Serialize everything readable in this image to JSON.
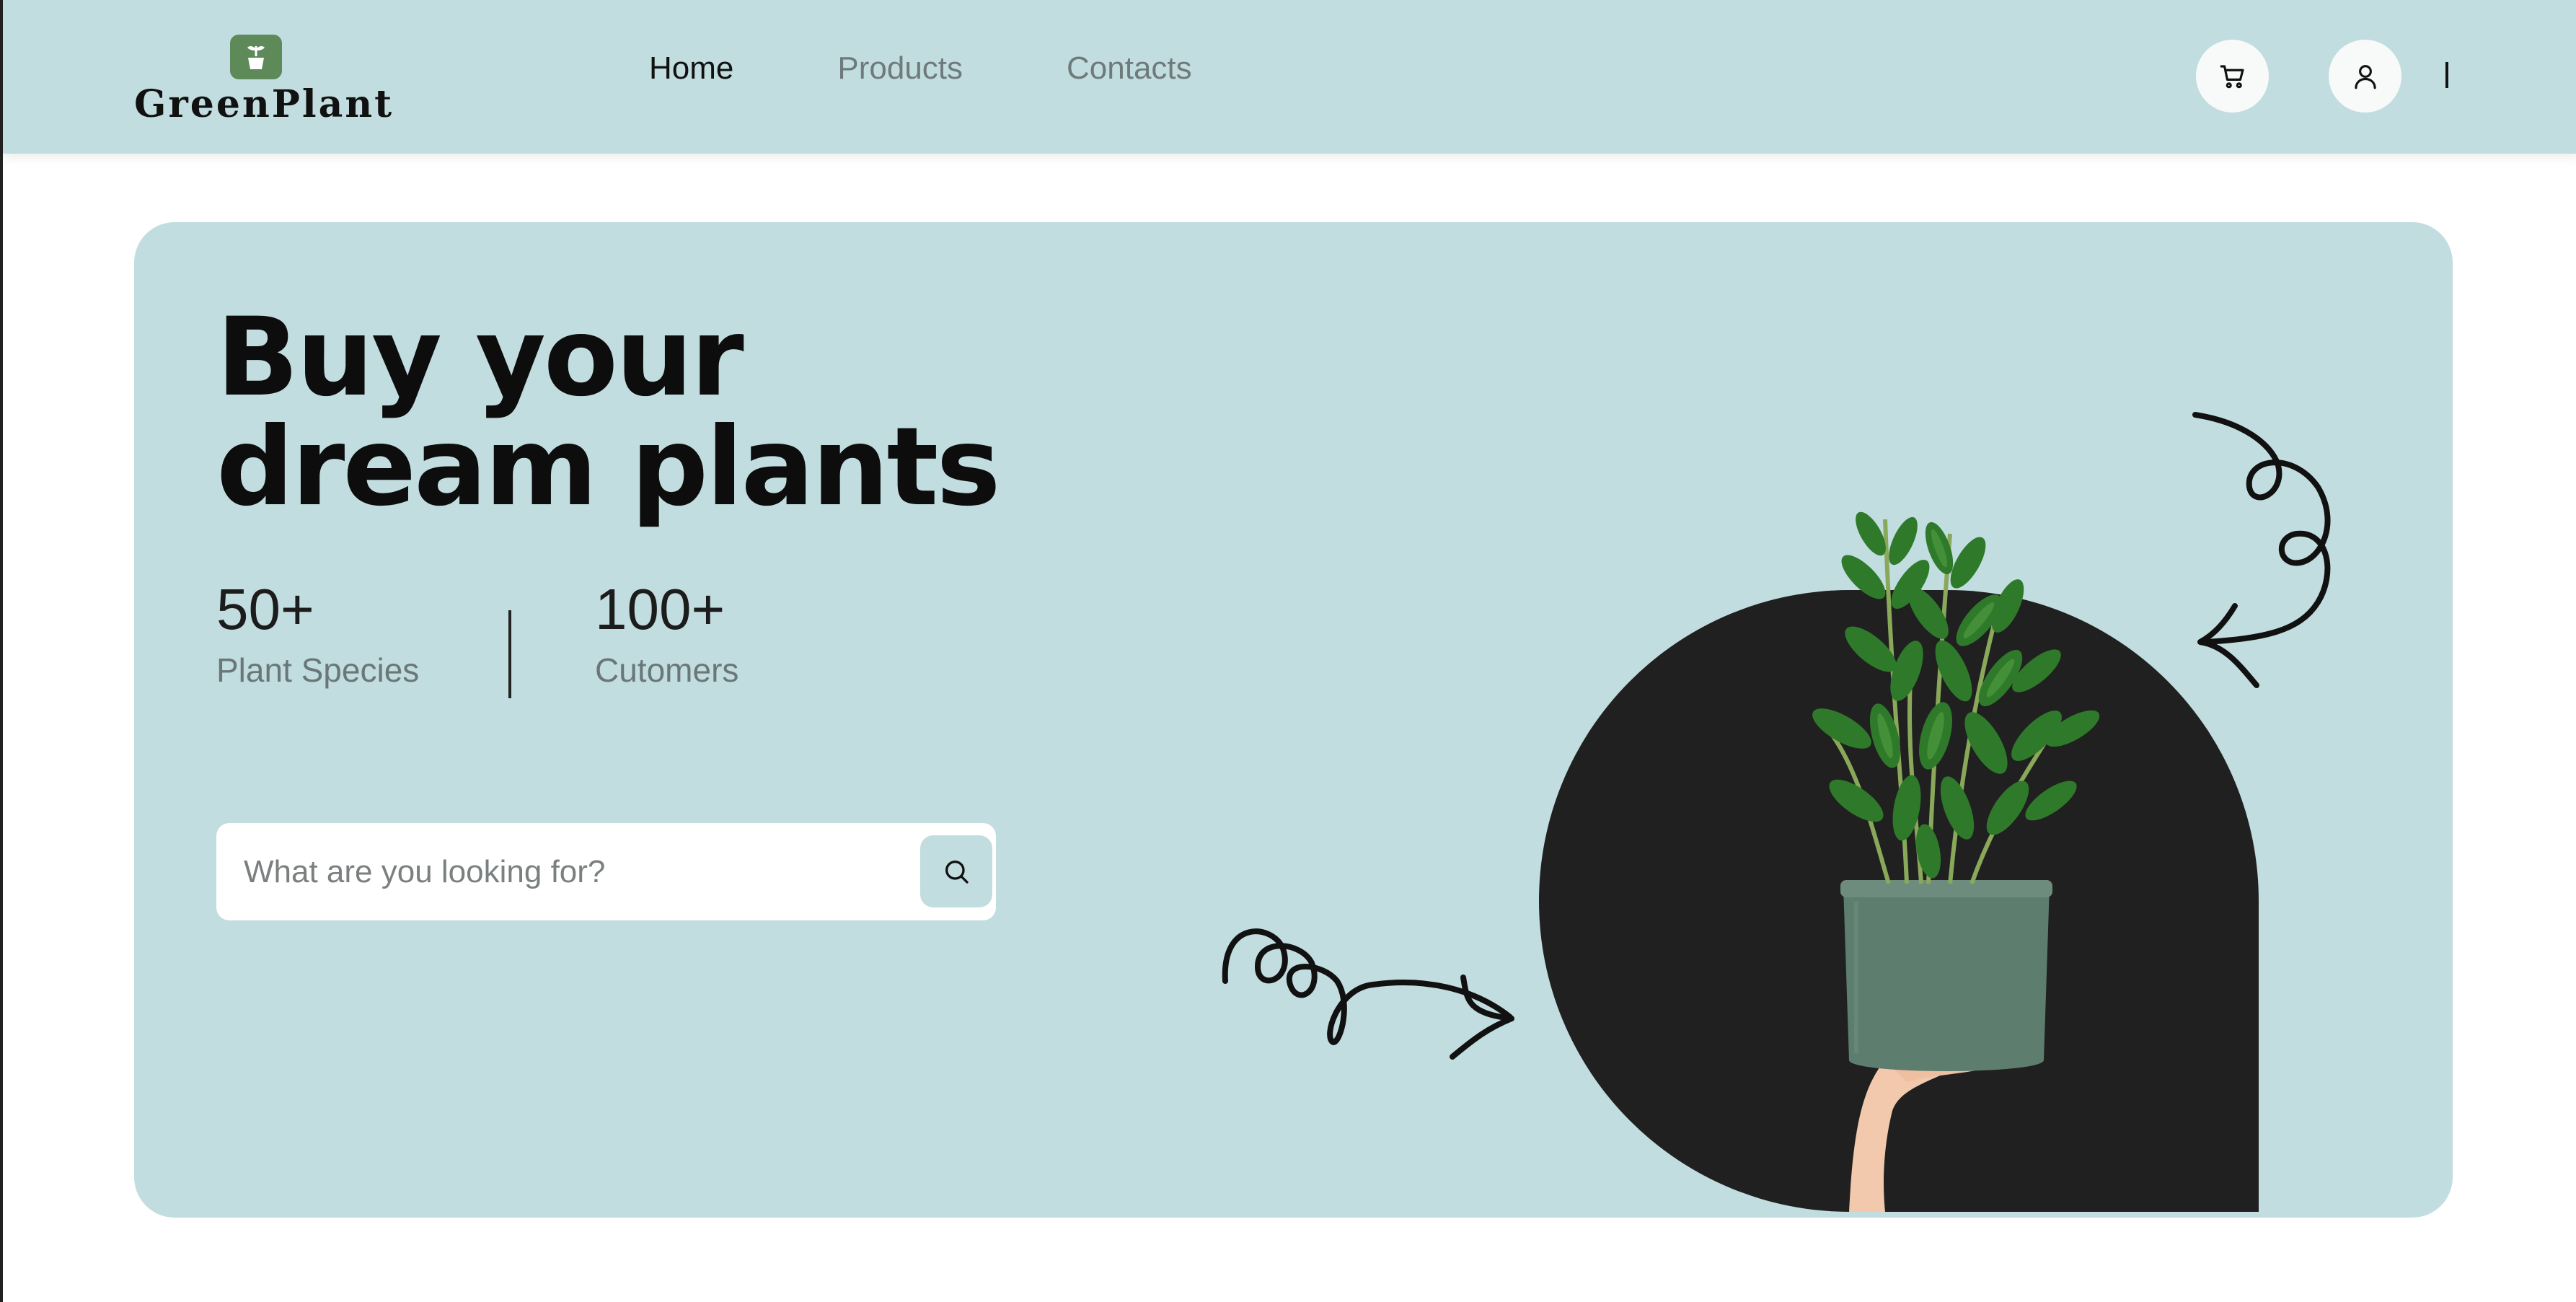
{
  "header": {
    "logo_text": "GreenPlant",
    "logo_icon": "potted-sprout-icon",
    "nav": [
      {
        "label": "Home",
        "active": true
      },
      {
        "label": "Products",
        "active": false
      },
      {
        "label": "Contacts",
        "active": false
      }
    ],
    "cart_icon": "cart-icon",
    "user_icon": "user-icon"
  },
  "hero": {
    "headline_line1": "Buy your",
    "headline_line2": "dream plants",
    "stats": [
      {
        "value": "50+",
        "label": "Plant Species"
      },
      {
        "value": "100+",
        "label": "Cutomers"
      }
    ],
    "search": {
      "placeholder": "What are you looking for?",
      "icon": "search-icon"
    },
    "image": "potted-zz-plant-held-by-hand",
    "decorations": [
      "curly-arrow-right",
      "curly-arrow-down-left"
    ]
  },
  "colors": {
    "mint": "#c2dddf",
    "dark": "#202020",
    "logo_green": "#5e8a5a",
    "pot_green": "#5a7a6c",
    "text_muted": "#6f7a7c"
  }
}
